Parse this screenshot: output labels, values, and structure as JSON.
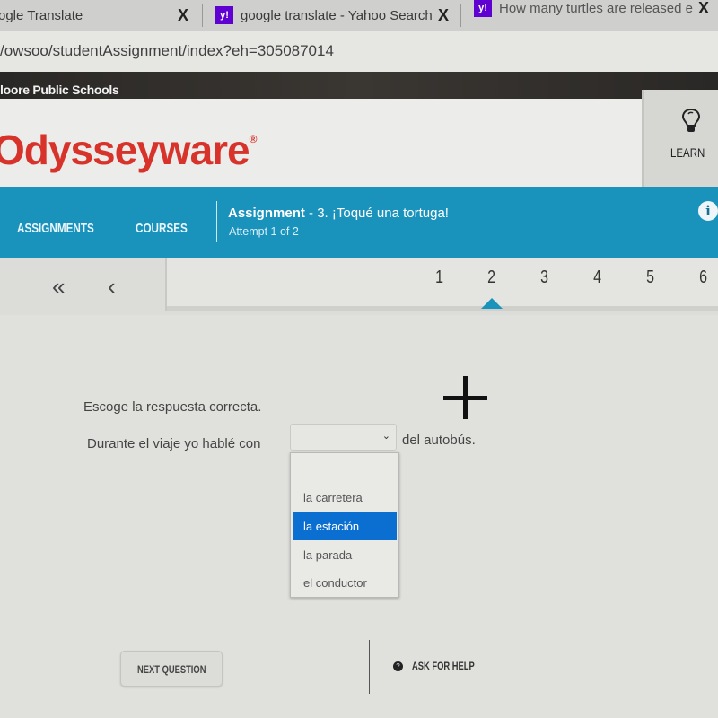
{
  "browser": {
    "tabs": [
      {
        "label": "ogle Translate",
        "icon": "google-translate-icon"
      },
      {
        "label": "google translate - Yahoo Search",
        "icon": "yahoo-icon"
      },
      {
        "label": "How many turtles are released e",
        "icon": "yahoo-icon"
      }
    ],
    "favicon_text": "y!",
    "close_glyph": "X",
    "url": "/owsoo/studentAssignment/index?eh=305087014"
  },
  "district": {
    "label": "loore Public Schools"
  },
  "header": {
    "logo": "Odysseyware",
    "logo_mark": "®",
    "learn_label": "LEARN",
    "brand_color": "#d8332b"
  },
  "nav": {
    "items": [
      {
        "label": "ASSIGNMENTS"
      },
      {
        "label": "COURSES"
      }
    ],
    "assignment_label": "Assignment",
    "assignment_title": " - 3. ¡Toqué una tortuga!",
    "attempt": "Attempt 1 of 2",
    "info_glyph": "i",
    "accent_color": "#1a93bc"
  },
  "pager": {
    "first_glyph": "«",
    "prev_glyph": "‹",
    "pages": [
      "1",
      "2",
      "3",
      "4",
      "5",
      "6"
    ],
    "current_page": "2"
  },
  "question": {
    "instruction": "Escoge la respuesta correcta.",
    "sentence_before": "Durante el viaje yo hablé con",
    "sentence_after": "del autobús.",
    "select_value": "",
    "chevron_glyph": "⌄",
    "options": [
      "la carretera",
      "la estación",
      "la parada",
      "el conductor"
    ],
    "highlighted_option": "la estación"
  },
  "footer": {
    "next_label": "NEXT QUESTION",
    "help_label": "ASK FOR HELP",
    "help_glyph": "?"
  }
}
